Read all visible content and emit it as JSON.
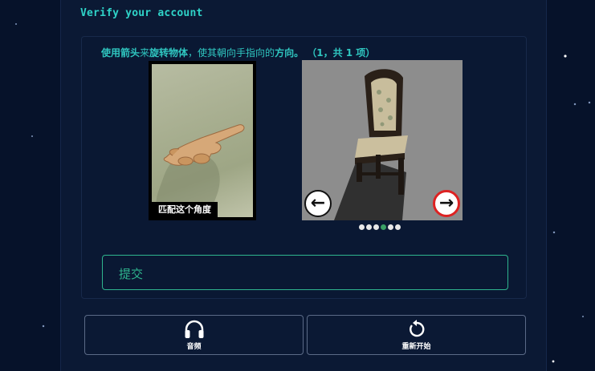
{
  "heading": "Verify your account",
  "instruction": {
    "part1": "使用箭头",
    "part2": "来",
    "part3": "旋转物体",
    "part4": "，使其朝向手指向的",
    "part5": "方向。",
    "part6": " （1，共 1 项）"
  },
  "reference": {
    "label": "匹配这个角度"
  },
  "object": {
    "left_arrow": "←",
    "right_arrow": "→"
  },
  "pager": {
    "count": 6,
    "active_index": 3
  },
  "submit": {
    "label": "提交"
  },
  "buttons": {
    "audio": "音频",
    "restart": "重新开始"
  },
  "colors": {
    "accent": "#2fd3c8",
    "submit": "#2fb58e",
    "active_dot": "#3aa066",
    "right_arrow_ring": "#dd2222"
  }
}
